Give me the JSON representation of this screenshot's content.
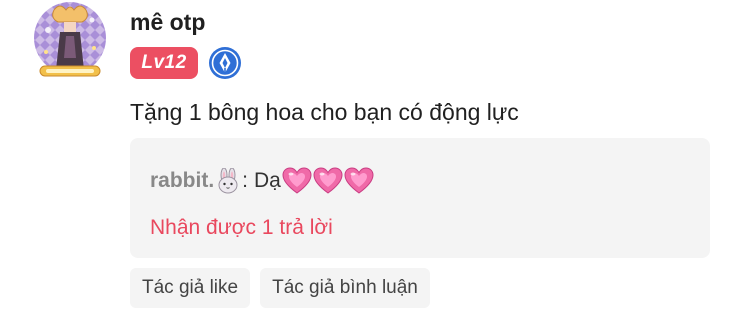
{
  "comment": {
    "username": "mê otp",
    "level_badge": "Lv12",
    "text": "Tặng 1 bông hoa cho bạn có động lực"
  },
  "reply": {
    "author": "rabbit.",
    "author_emoji": "rabbit-emoji",
    "colon": ":",
    "text": "Dạ",
    "hearts": [
      "heart-emoji",
      "heart-emoji",
      "heart-emoji"
    ],
    "reply_count_label": "Nhận được 1 trả lời"
  },
  "tags": [
    {
      "label": "Tác giả like"
    },
    {
      "label": "Tác giả bình luận"
    }
  ],
  "colors": {
    "level_badge_bg": "#ec4f62",
    "reply_count": "#e9485e",
    "verify_badge": "#2f6fd6",
    "reply_box_bg": "#f4f4f4"
  }
}
